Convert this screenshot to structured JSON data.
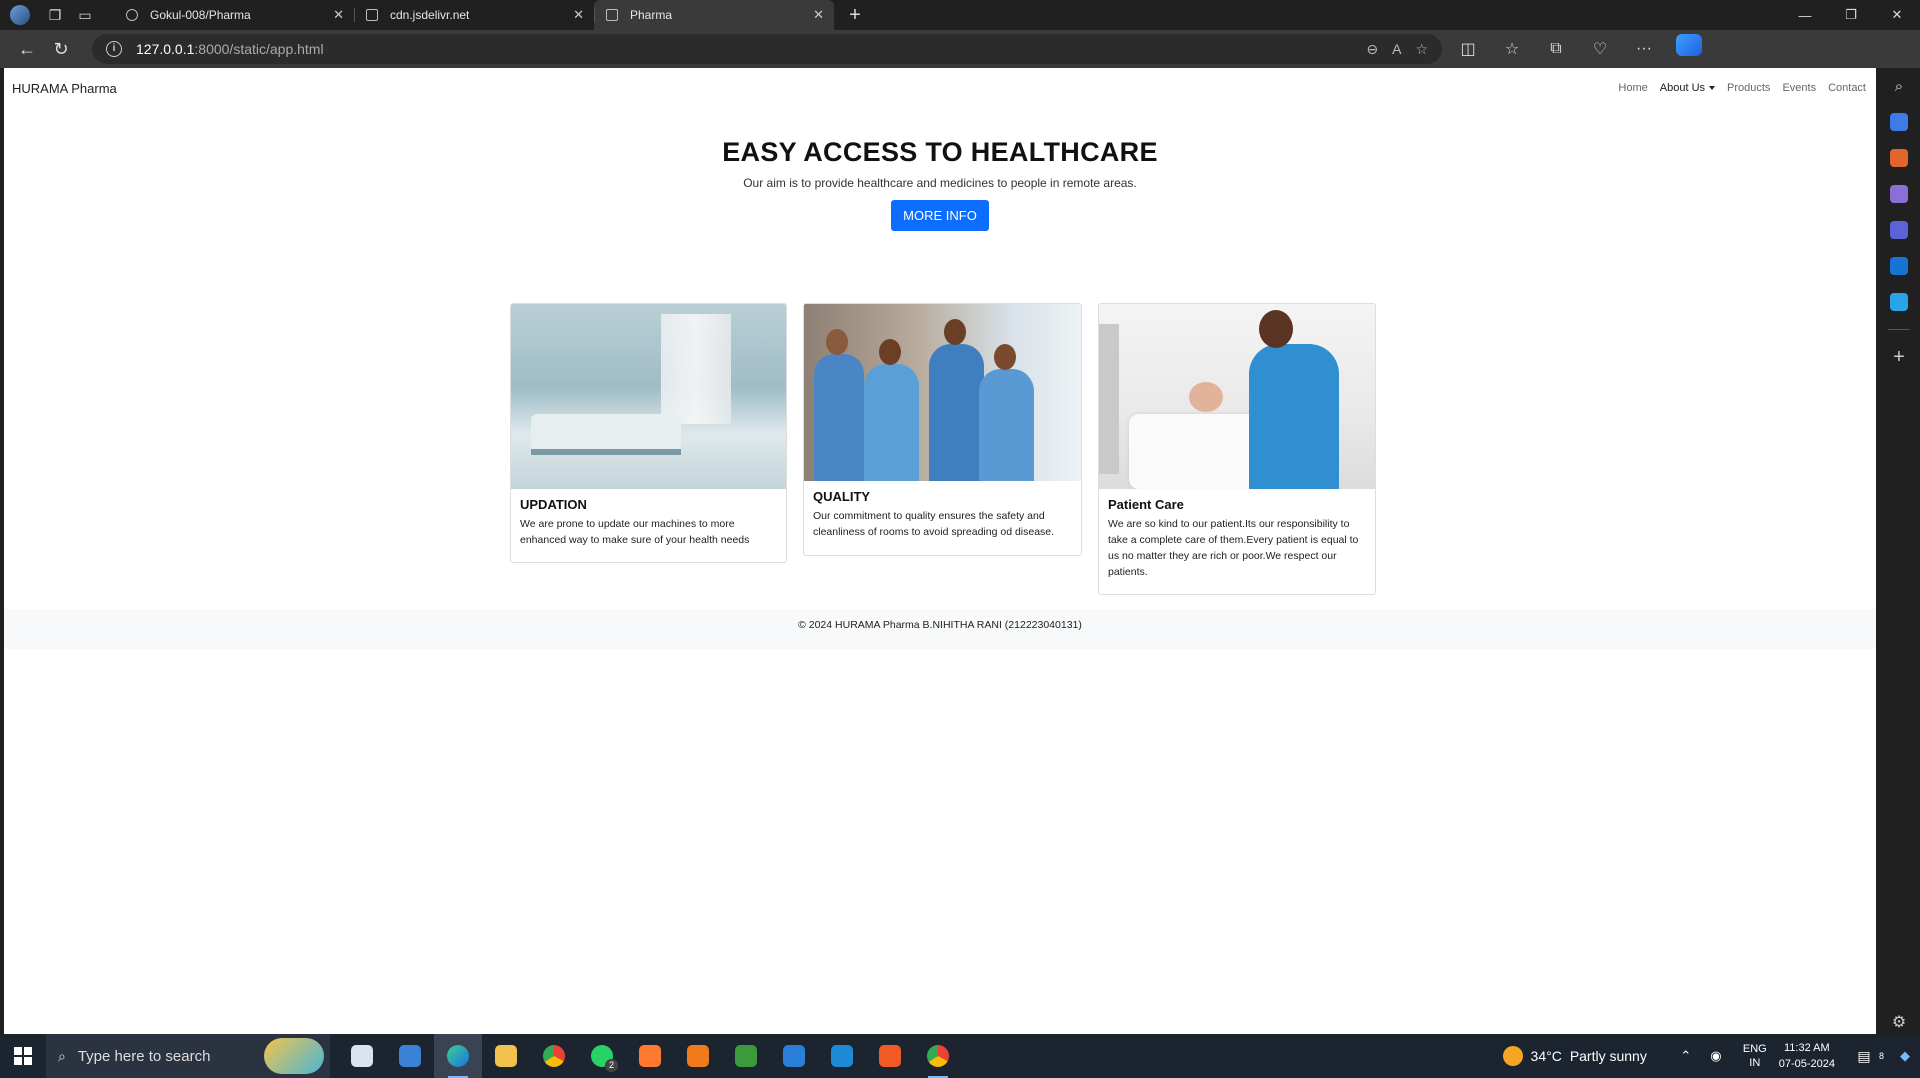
{
  "browser": {
    "tabs": [
      {
        "title": "Gokul-008/Pharma"
      },
      {
        "title": "cdn.jsdelivr.net"
      },
      {
        "title": "Pharma"
      }
    ],
    "url_host": "127.0.0.1",
    "url_rest": ":8000/static/app.html"
  },
  "site": {
    "brand": "HURAMA Pharma",
    "nav": {
      "home": "Home",
      "about": "About Us",
      "products": "Products",
      "events": "Events",
      "contact": "Contact"
    },
    "hero": {
      "title": "EASY ACCESS TO HEALTHCARE",
      "subtitle": "Our aim is to provide healthcare and medicines to people in remote areas.",
      "button": "MORE INFO"
    },
    "cards": [
      {
        "title": "UPDATION",
        "text": "We are prone to update our machines to more enhanced way to make sure of your health needs"
      },
      {
        "title": "QUALITY",
        "text": "Our commitment to quality ensures the safety and cleanliness of rooms to avoid spreading od disease."
      },
      {
        "title": "Patient Care",
        "text": "We are so kind to our patient.Its our responsibility to take a complete care of them.Every patient is equal to us no matter they are rich or poor.We respect our patients."
      }
    ],
    "footer": "© 2024 HURAMA Pharma B.NIHITHA RANI (212223040131)"
  },
  "taskbar": {
    "search_placeholder": "Type here to search",
    "whatsapp_badge": "2",
    "weather_temp": "34°C",
    "weather_desc": "Partly sunny",
    "lang_top": "ENG",
    "lang_bottom": "IN",
    "time": "11:32 AM",
    "date": "07-05-2024",
    "notif_count": "8"
  },
  "colors": {
    "accent": "#0d6efd",
    "footer_bg": "#f8f9fa"
  }
}
